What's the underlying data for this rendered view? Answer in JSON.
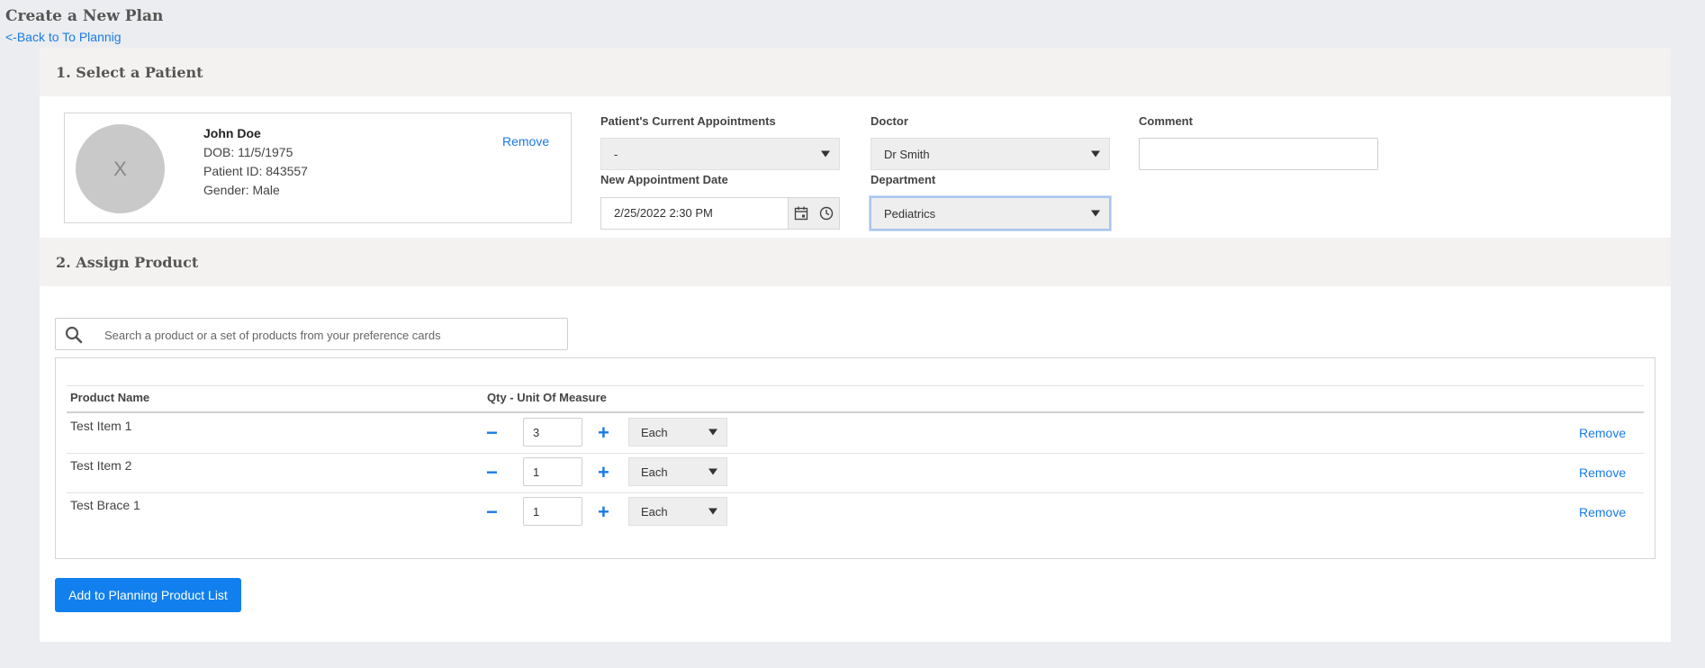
{
  "page": {
    "title": "Create a New Plan",
    "back_link": "<-Back to To Plannig"
  },
  "section1": {
    "title": "1. Select a Patient",
    "patient": {
      "avatar_initial": "X",
      "name": "John Doe",
      "dob": "DOB: 11/5/1975",
      "patient_id": "Patient ID: 843557",
      "gender": "Gender: Male",
      "remove_label": "Remove"
    },
    "current_appointments": {
      "label": "Patient's Current Appointments",
      "value": "-"
    },
    "doctor": {
      "label": "Doctor",
      "value": "Dr Smith"
    },
    "comment": {
      "label": "Comment",
      "value": ""
    },
    "new_appointment_date": {
      "label": "New Appointment Date",
      "value": "2/25/2022 2:30 PM"
    },
    "department": {
      "label": "Department",
      "value": "Pediatrics"
    }
  },
  "section2": {
    "title": "2. Assign Product",
    "search": {
      "placeholder": "Search a product or a set of products from your preference cards"
    },
    "table": {
      "headers": {
        "product_name": "Product Name",
        "qty_uom": "Qty - Unit Of Measure"
      },
      "rows": [
        {
          "name": "Test Item 1",
          "qty": "3",
          "uom": "Each",
          "remove": "Remove"
        },
        {
          "name": "Test Item 2",
          "qty": "1",
          "uom": "Each",
          "remove": "Remove"
        },
        {
          "name": "Test Brace 1",
          "qty": "1",
          "uom": "Each",
          "remove": "Remove"
        }
      ]
    },
    "stepper": {
      "minus": "−",
      "plus": "+"
    },
    "add_button": "Add to Planning Product List"
  },
  "icons": {
    "calendar": "calendar-icon",
    "clock": "clock-icon",
    "search": "search-icon",
    "caret": "caret-down-icon"
  },
  "colors": {
    "accent": "#1180ee",
    "link": "#1a7be6",
    "page_background": "#ebedf0",
    "section_header": "#f4f2f1"
  }
}
